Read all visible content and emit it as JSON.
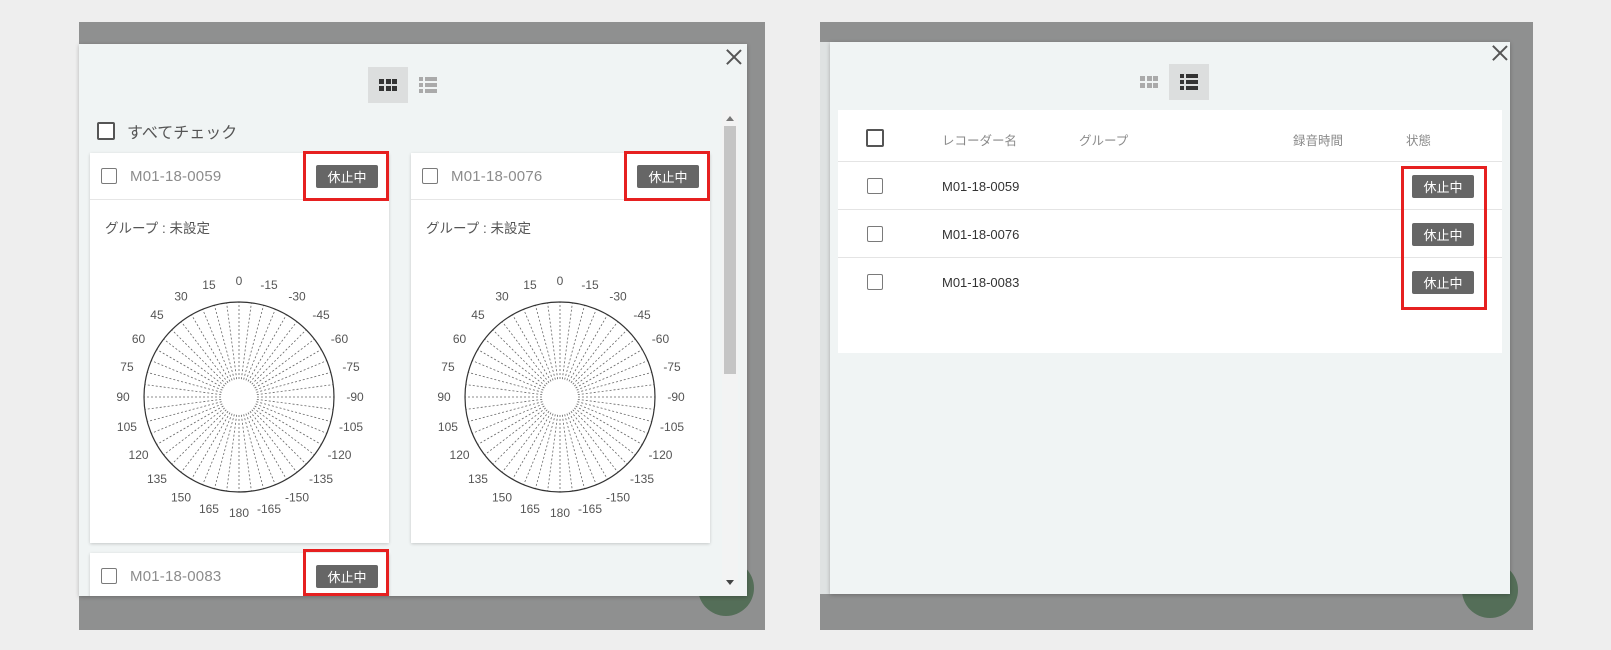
{
  "left_panel": {
    "view_toggle": {
      "grid_icon": "grid-view-icon",
      "list_icon": "list-view-icon",
      "active": "grid"
    },
    "close_icon": "close-icon",
    "select_all_label": "すべてチェック",
    "cards": [
      {
        "name": "M01-18-0059",
        "status": "休止中",
        "group": "グループ : 未設定"
      },
      {
        "name": "M01-18-0076",
        "status": "休止中",
        "group": "グループ : 未設定"
      },
      {
        "name": "M01-18-0083",
        "status": "休止中"
      }
    ],
    "dial_labels": [
      "0",
      "-15",
      "-30",
      "-45",
      "-60",
      "-75",
      "-90",
      "-105",
      "-120",
      "-135",
      "-150",
      "-165",
      "180",
      "165",
      "150",
      "135",
      "120",
      "105",
      "90",
      "75",
      "60",
      "45",
      "30",
      "15"
    ]
  },
  "right_panel": {
    "view_toggle": {
      "grid_icon": "grid-view-icon",
      "list_icon": "list-view-icon",
      "active": "list"
    },
    "close_icon": "close-icon",
    "table": {
      "headers": {
        "name": "レコーダー名",
        "group": "グループ",
        "time": "録音時間",
        "status": "状態"
      },
      "rows": [
        {
          "name": "M01-18-0059",
          "status": "休止中"
        },
        {
          "name": "M01-18-0076",
          "status": "休止中"
        },
        {
          "name": "M01-18-0083",
          "status": "休止中"
        }
      ]
    }
  },
  "colors": {
    "highlight": "#e62020",
    "badge": "#666666",
    "overlay": "#8f9090",
    "modal": "#f0f4f4",
    "fab": "#546e58"
  }
}
